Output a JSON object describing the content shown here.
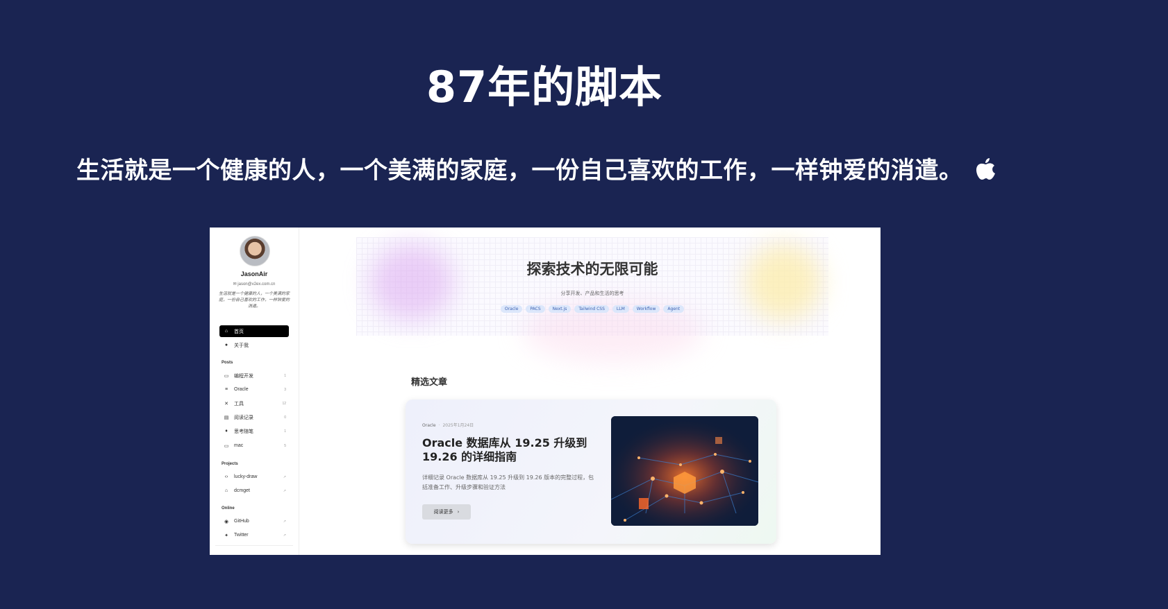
{
  "hero": {
    "title": "87年的脚本",
    "motto": "生活就是一个健康的人，一个美满的家庭，一份自己喜欢的工作，一样钟爱的消遣。",
    "motto_icon": "apple-icon"
  },
  "sidebar": {
    "name": "JasonAir",
    "email": "jason@v2ex.com.cn",
    "bio": "生活就是一个健康的人，一个美满的家庭，一份自己喜欢的工作，一样钟爱的消遣。",
    "nav": [
      {
        "label": "首页",
        "icon": "home-icon",
        "active": true
      },
      {
        "label": "关于我",
        "icon": "user-icon"
      }
    ],
    "posts_heading": "Posts",
    "posts": [
      {
        "label": "编程开发",
        "count": "1",
        "icon": "laptop-icon"
      },
      {
        "label": "Oracle",
        "count": "3",
        "icon": "database-icon"
      },
      {
        "label": "工具",
        "count": "12",
        "icon": "tools-icon"
      },
      {
        "label": "阅读记录",
        "count": "0",
        "icon": "book-icon"
      },
      {
        "label": "思考随笔",
        "count": "1",
        "icon": "lightbulb-icon"
      },
      {
        "label": "mac",
        "count": "5",
        "icon": "laptop-icon"
      }
    ],
    "projects_heading": "Projects",
    "projects": [
      {
        "label": "lucky-draw",
        "icon": "code-icon"
      },
      {
        "label": "dcmget",
        "icon": "building-icon"
      }
    ],
    "online_heading": "Online",
    "online": [
      {
        "label": "GitHub",
        "icon": "github-icon"
      },
      {
        "label": "Twitter",
        "icon": "twitter-icon"
      }
    ]
  },
  "banner": {
    "title": "探索技术的无限可能",
    "subtitle": "分享开发、产品和生活的思考",
    "tags": [
      "Oracle",
      "PACS",
      "Next.js",
      "Tailwind CSS",
      "LLM",
      "Workflow",
      "Agent"
    ]
  },
  "featured": {
    "heading": "精选文章",
    "category": "Oracle",
    "date": "2025年1月24日",
    "title": "Oracle 数据库从 19.25 升级到 19.26 的详细指南",
    "description": "详细记录 Oracle 数据库从 19.25 升级到 19.26 版本的完整过程，包括准备工作、升级步骤和验证方法",
    "button": "阅读更多"
  },
  "colors": {
    "background": "#1a2452",
    "active_nav": "#000000",
    "tag_bg": "#dce7fb",
    "tag_text": "#3a5fb0"
  }
}
